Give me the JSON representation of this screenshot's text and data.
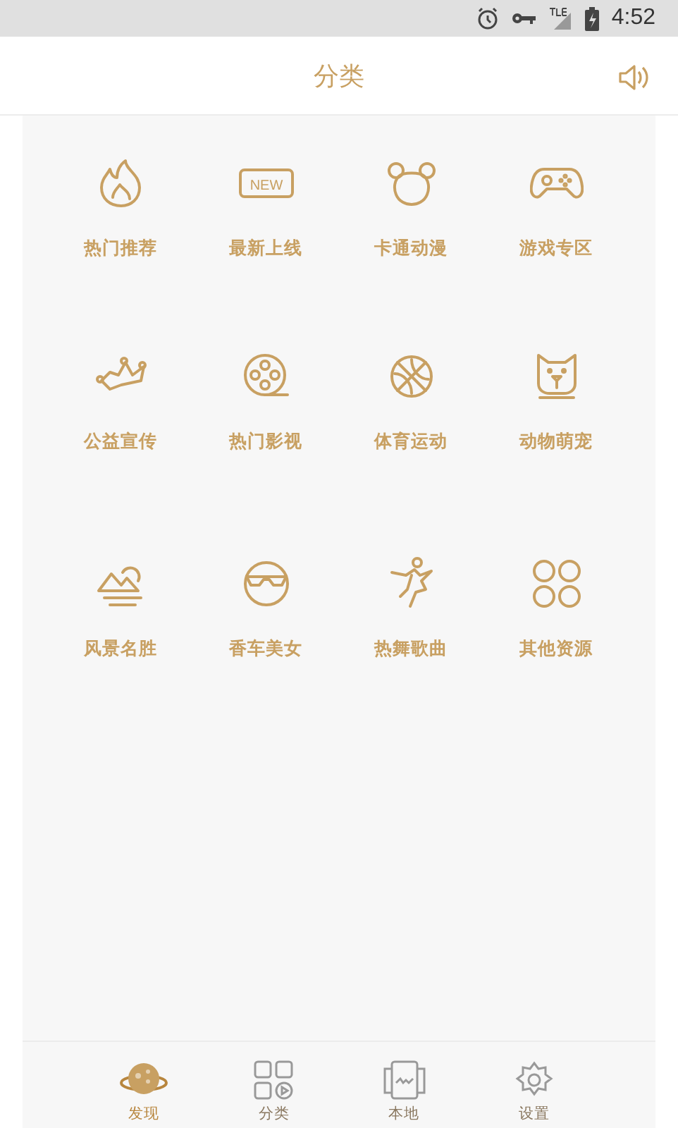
{
  "status_bar": {
    "time": "4:52"
  },
  "header": {
    "title": "分类"
  },
  "categories": [
    {
      "label": "热门推荐",
      "kind": "fire"
    },
    {
      "label": "最新上线",
      "kind": "new",
      "badge": "NEW"
    },
    {
      "label": "卡通动漫",
      "kind": "bear"
    },
    {
      "label": "游戏专区",
      "kind": "gamepad"
    },
    {
      "label": "公益宣传",
      "kind": "crown"
    },
    {
      "label": "热门影视",
      "kind": "film"
    },
    {
      "label": "体育运动",
      "kind": "ball"
    },
    {
      "label": "动物萌宠",
      "kind": "pet"
    },
    {
      "label": "风景名胜",
      "kind": "mountain"
    },
    {
      "label": "香车美女",
      "kind": "face"
    },
    {
      "label": "热舞歌曲",
      "kind": "dancer"
    },
    {
      "label": "其他资源",
      "kind": "clover"
    }
  ],
  "tabs": [
    {
      "label": "发现",
      "kind": "planet",
      "selected": true
    },
    {
      "label": "分类",
      "kind": "grid",
      "selected": false
    },
    {
      "label": "本地",
      "kind": "local",
      "selected": false
    },
    {
      "label": "设置",
      "kind": "gear",
      "selected": false
    }
  ]
}
